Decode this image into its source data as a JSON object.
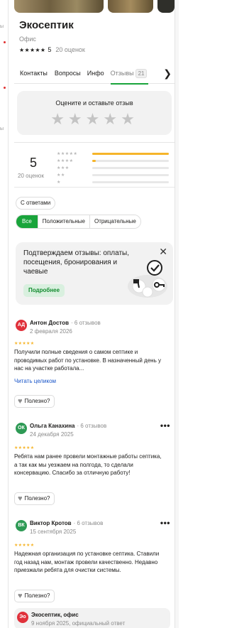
{
  "left_edge": {
    "fragment_1": "ы",
    "fragment_2": "ы"
  },
  "business": {
    "name": "Экосептик",
    "category": "Офис",
    "stars": "★★★★★",
    "rating": "5",
    "review_count": "20 оценок"
  },
  "tabs": [
    {
      "label": "Контакты"
    },
    {
      "label": "Вопросы"
    },
    {
      "label": "Инфо"
    },
    {
      "label": "Отзывы",
      "count": "21"
    }
  ],
  "tab_arrow": "❯",
  "rate_box": {
    "title": "Оцените и оставьте отзыв",
    "stars": "★★★★★"
  },
  "summary": {
    "score": "5",
    "sub": "20 оценок",
    "distribution": [
      {
        "stars": "★★★★★",
        "fill": 1.0
      },
      {
        "stars": "★★★★",
        "fill": 0.05
      },
      {
        "stars": "★★★",
        "fill": 0
      },
      {
        "stars": "★★",
        "fill": 0
      },
      {
        "stars": "★",
        "fill": 0
      }
    ]
  },
  "filters": {
    "with_answers": "С ответами",
    "all": "Все",
    "positive": "Положительные",
    "negative": "Отрицательные"
  },
  "promo": {
    "text": "Подтверждаем отзывы: оплаты, посещения, бронирования и чаевые",
    "button": "Подробнее",
    "close": "✕"
  },
  "reviews": [
    {
      "initials": "АД",
      "avatar_color": "#e0313b",
      "name": "Антон Достов",
      "count": "· 6 отзывов",
      "date": "2 февраля 2026",
      "stars": "★★★★★",
      "text": "Получили полные сведения о самом септике и проводимых работ по установке. В назначенный день у нас на участке работала...",
      "more": "Читать целиком",
      "useful": "Полезно?"
    },
    {
      "initials": "ОК",
      "avatar_color": "#2e9a55",
      "name": "Ольга Канахина",
      "count": "· 6 отзывов",
      "date": "24 декабря 2025",
      "stars": "★★★★★",
      "text": "Ребята нам ранее провели монтажные работы септика, а так как мы уезжаем на полгода, то сделали консервацию. Спасибо за отличную работу!",
      "useful": "Полезно?"
    },
    {
      "initials": "ВК",
      "avatar_color": "#2e9a55",
      "name": "Виктор Кротов",
      "count": "· 6 отзывов",
      "date": "15 сентября 2025",
      "stars": "★★★★★",
      "text": "Надежная организация по установке септика. Ставили год назад нам, монтаж провели качественно. Недавно приезжали ребята для очистки системы.",
      "useful": "Полезно?"
    }
  ],
  "owner_reply": {
    "initials": "Эо",
    "name": "Экосептик, офис",
    "meta": "9 ноября 2025, официальный ответ"
  },
  "colors": {
    "accent": "#19a43b",
    "star": "#f6b52a",
    "link": "#1a56c9"
  }
}
